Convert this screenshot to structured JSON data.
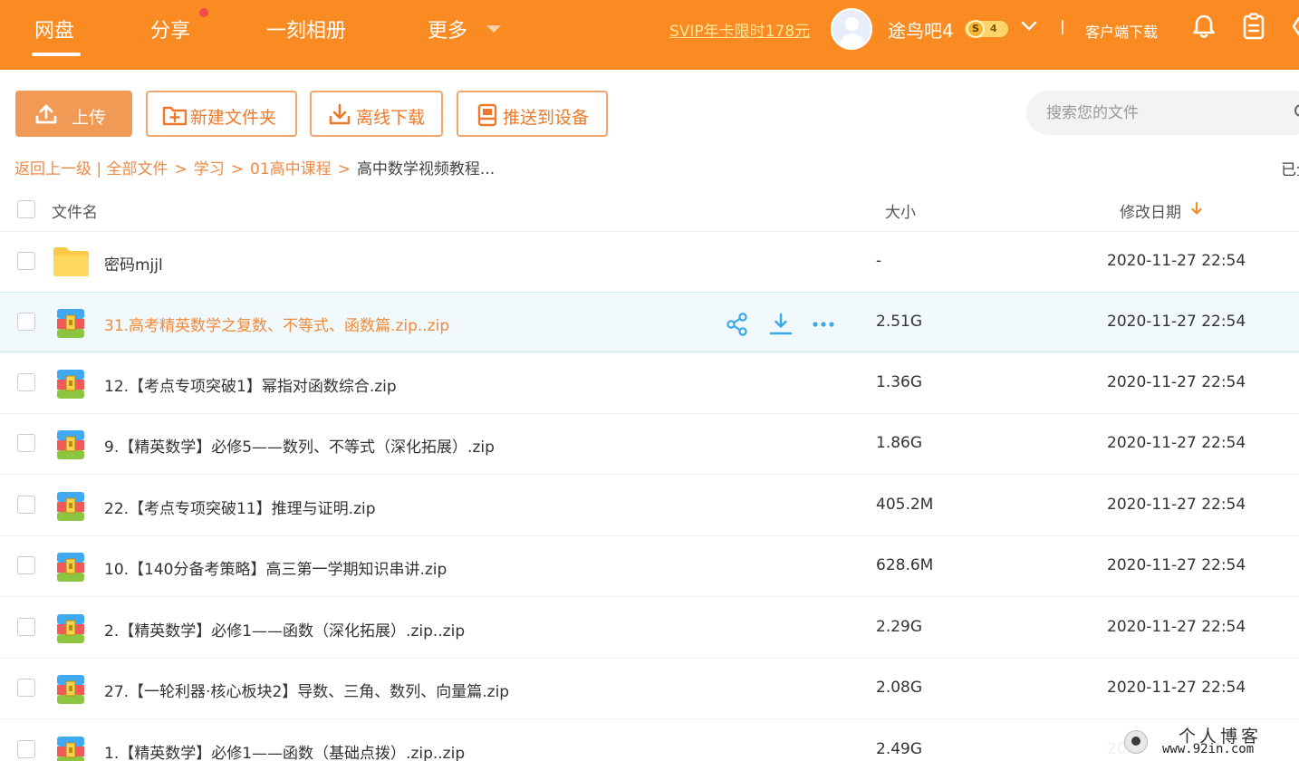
{
  "nav": {
    "items": [
      "网盘",
      "分享",
      "一刻相册",
      "更多"
    ],
    "svip_promo": "SVIP年卡限时178元",
    "username": "途鸟吧4",
    "level": "4",
    "coin_letter": "S",
    "client_download": "客户端下载"
  },
  "toolbar": {
    "upload": "上传",
    "new_folder": "新建文件夹",
    "offline_download": "离线下载",
    "push_to_device": "推送到设备",
    "search_placeholder": "搜索您的文件"
  },
  "breadcrumb": {
    "back": "返回上一级",
    "sep1": "|",
    "all_files": "全部文件",
    "gt": ">",
    "level1": "学习",
    "level2": "01高中课程",
    "current": "高中数学视频教程...",
    "loaded_status": "已全"
  },
  "table": {
    "headers": {
      "name": "文件名",
      "size": "大小",
      "modified": "修改日期"
    },
    "rows": [
      {
        "type": "folder",
        "name": "密码mjjl",
        "size": "-",
        "date": "2020-11-27 22:54"
      },
      {
        "type": "zip",
        "name": "31.高考精英数学之复数、不等式、函数篇.zip..zip",
        "size": "2.51G",
        "date": "2020-11-27 22:54"
      },
      {
        "type": "zip",
        "name": "12.【考点专项突破1】幂指对函数综合.zip",
        "size": "1.36G",
        "date": "2020-11-27 22:54"
      },
      {
        "type": "zip",
        "name": "9.【精英数学】必修5——数列、不等式（深化拓展）.zip",
        "size": "1.86G",
        "date": "2020-11-27 22:54"
      },
      {
        "type": "zip",
        "name": "22.【考点专项突破11】推理与证明.zip",
        "size": "405.2M",
        "date": "2020-11-27 22:54"
      },
      {
        "type": "zip",
        "name": "10.【140分备考策略】高三第一学期知识串讲.zip",
        "size": "628.6M",
        "date": "2020-11-27 22:54"
      },
      {
        "type": "zip",
        "name": "2.【精英数学】必修1——函数（深化拓展）.zip..zip",
        "size": "2.29G",
        "date": "2020-11-27 22:54"
      },
      {
        "type": "zip",
        "name": "27.【一轮利器·核心板块2】导数、三角、数列、向量篇.zip",
        "size": "2.08G",
        "date": "2020-11-27 22:54"
      },
      {
        "type": "zip",
        "name": "1.【精英数学】必修1——函数（基础点拨）.zip..zip",
        "size": "2.49G",
        "date": "20"
      }
    ]
  },
  "watermark": {
    "title": "个人博客",
    "url": "www.92in.com"
  },
  "colors": {
    "brand": "#f98b22",
    "accent": "#ef8b3a",
    "row_highlight": "#f2f9fd",
    "action_blue": "#3aa9e8"
  },
  "icons": {
    "upload": "upload-icon",
    "new_folder": "folder-plus-icon",
    "offline": "download-icon",
    "push": "device-icon",
    "search": "search-icon",
    "bell": "bell-icon",
    "clipboard": "clipboard-icon",
    "share": "share-icon",
    "more": "more-icon",
    "folder": "folder-icon",
    "zip": "zip-icon",
    "sort": "arrow-down-icon",
    "chevron": "chevron-down-icon"
  }
}
